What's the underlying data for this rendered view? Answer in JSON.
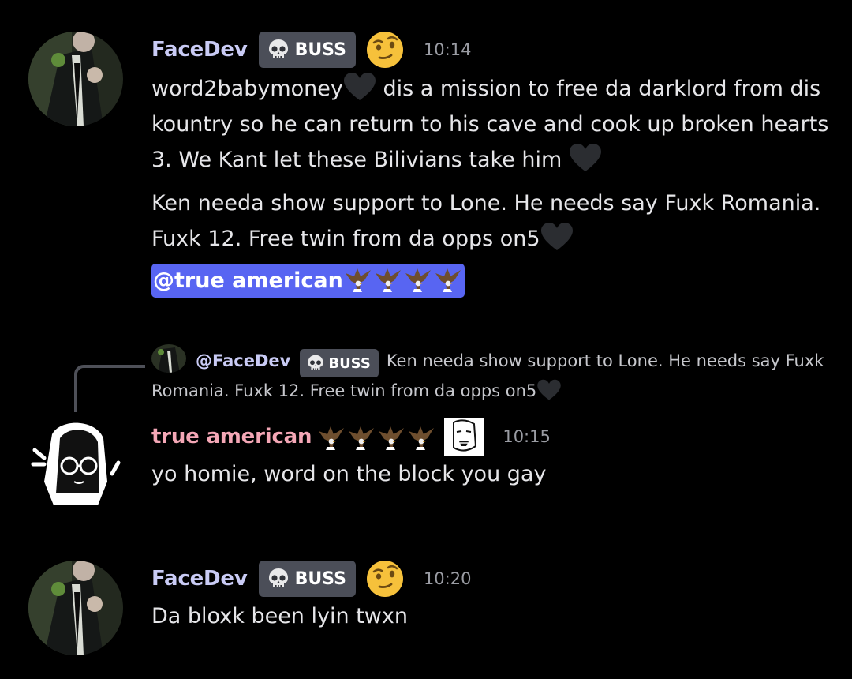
{
  "colors": {
    "background": "#000000",
    "facedev_name": "#c9cbf5",
    "true_american_name": "#f4a7b6",
    "tag_bg": "#4b4e58",
    "mention_bg": "#5865f2",
    "timestamp": "#9a9ca3",
    "text": "#e6e6e9"
  },
  "messages": [
    {
      "author": "FaceDev",
      "tag": "BUSS",
      "tag_icon": "skull-icon",
      "status_emoji": "raised-eyebrow-face-icon",
      "time": "10:14",
      "lines": {
        "p1_a": "word2babymoney",
        "p1_b": " dis a mission to free da darklord from dis kountry so he can return to his cave and cook up broken hearts 3. We Kant let these Bilivians take him ",
        "p2": "Ken needa show support to Lone. He needs say Fuxk Romania. Fuxk 12. Free twin from da opps on5",
        "mention": "@true american"
      }
    },
    {
      "reply": {
        "author": "@FaceDev",
        "tag": "BUSS",
        "text": "Ken needa show support to Lone. He needs say Fuxk Romania. Fuxk 12. Free twin from da opps on5"
      },
      "author": "true american",
      "time": "10:15",
      "text": "yo homie, word on the block you gay"
    },
    {
      "author": "FaceDev",
      "tag": "BUSS",
      "status_emoji": "raised-eyebrow-face-icon",
      "time": "10:20",
      "text": "Da bloxk been lyin twxn"
    }
  ]
}
